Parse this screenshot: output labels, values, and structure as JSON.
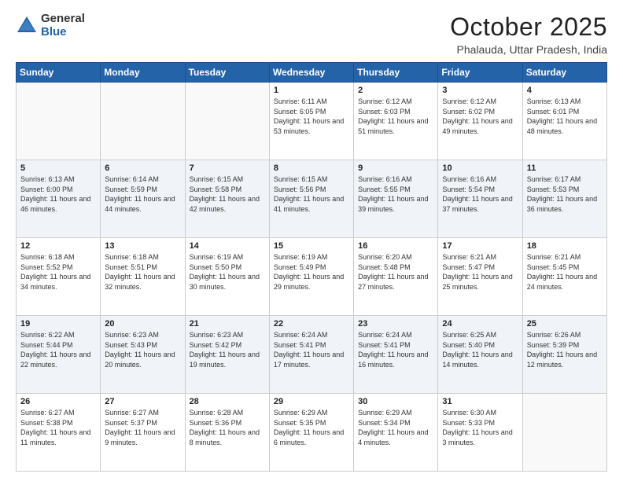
{
  "header": {
    "logo_general": "General",
    "logo_blue": "Blue",
    "title": "October 2025",
    "location": "Phalauda, Uttar Pradesh, India"
  },
  "days_of_week": [
    "Sunday",
    "Monday",
    "Tuesday",
    "Wednesday",
    "Thursday",
    "Friday",
    "Saturday"
  ],
  "weeks": [
    [
      {
        "day": "",
        "text": ""
      },
      {
        "day": "",
        "text": ""
      },
      {
        "day": "",
        "text": ""
      },
      {
        "day": "1",
        "text": "Sunrise: 6:11 AM\nSunset: 6:05 PM\nDaylight: 11 hours and 53 minutes."
      },
      {
        "day": "2",
        "text": "Sunrise: 6:12 AM\nSunset: 6:03 PM\nDaylight: 11 hours and 51 minutes."
      },
      {
        "day": "3",
        "text": "Sunrise: 6:12 AM\nSunset: 6:02 PM\nDaylight: 11 hours and 49 minutes."
      },
      {
        "day": "4",
        "text": "Sunrise: 6:13 AM\nSunset: 6:01 PM\nDaylight: 11 hours and 48 minutes."
      }
    ],
    [
      {
        "day": "5",
        "text": "Sunrise: 6:13 AM\nSunset: 6:00 PM\nDaylight: 11 hours and 46 minutes."
      },
      {
        "day": "6",
        "text": "Sunrise: 6:14 AM\nSunset: 5:59 PM\nDaylight: 11 hours and 44 minutes."
      },
      {
        "day": "7",
        "text": "Sunrise: 6:15 AM\nSunset: 5:58 PM\nDaylight: 11 hours and 42 minutes."
      },
      {
        "day": "8",
        "text": "Sunrise: 6:15 AM\nSunset: 5:56 PM\nDaylight: 11 hours and 41 minutes."
      },
      {
        "day": "9",
        "text": "Sunrise: 6:16 AM\nSunset: 5:55 PM\nDaylight: 11 hours and 39 minutes."
      },
      {
        "day": "10",
        "text": "Sunrise: 6:16 AM\nSunset: 5:54 PM\nDaylight: 11 hours and 37 minutes."
      },
      {
        "day": "11",
        "text": "Sunrise: 6:17 AM\nSunset: 5:53 PM\nDaylight: 11 hours and 36 minutes."
      }
    ],
    [
      {
        "day": "12",
        "text": "Sunrise: 6:18 AM\nSunset: 5:52 PM\nDaylight: 11 hours and 34 minutes."
      },
      {
        "day": "13",
        "text": "Sunrise: 6:18 AM\nSunset: 5:51 PM\nDaylight: 11 hours and 32 minutes."
      },
      {
        "day": "14",
        "text": "Sunrise: 6:19 AM\nSunset: 5:50 PM\nDaylight: 11 hours and 30 minutes."
      },
      {
        "day": "15",
        "text": "Sunrise: 6:19 AM\nSunset: 5:49 PM\nDaylight: 11 hours and 29 minutes."
      },
      {
        "day": "16",
        "text": "Sunrise: 6:20 AM\nSunset: 5:48 PM\nDaylight: 11 hours and 27 minutes."
      },
      {
        "day": "17",
        "text": "Sunrise: 6:21 AM\nSunset: 5:47 PM\nDaylight: 11 hours and 25 minutes."
      },
      {
        "day": "18",
        "text": "Sunrise: 6:21 AM\nSunset: 5:45 PM\nDaylight: 11 hours and 24 minutes."
      }
    ],
    [
      {
        "day": "19",
        "text": "Sunrise: 6:22 AM\nSunset: 5:44 PM\nDaylight: 11 hours and 22 minutes."
      },
      {
        "day": "20",
        "text": "Sunrise: 6:23 AM\nSunset: 5:43 PM\nDaylight: 11 hours and 20 minutes."
      },
      {
        "day": "21",
        "text": "Sunrise: 6:23 AM\nSunset: 5:42 PM\nDaylight: 11 hours and 19 minutes."
      },
      {
        "day": "22",
        "text": "Sunrise: 6:24 AM\nSunset: 5:41 PM\nDaylight: 11 hours and 17 minutes."
      },
      {
        "day": "23",
        "text": "Sunrise: 6:24 AM\nSunset: 5:41 PM\nDaylight: 11 hours and 16 minutes."
      },
      {
        "day": "24",
        "text": "Sunrise: 6:25 AM\nSunset: 5:40 PM\nDaylight: 11 hours and 14 minutes."
      },
      {
        "day": "25",
        "text": "Sunrise: 6:26 AM\nSunset: 5:39 PM\nDaylight: 11 hours and 12 minutes."
      }
    ],
    [
      {
        "day": "26",
        "text": "Sunrise: 6:27 AM\nSunset: 5:38 PM\nDaylight: 11 hours and 11 minutes."
      },
      {
        "day": "27",
        "text": "Sunrise: 6:27 AM\nSunset: 5:37 PM\nDaylight: 11 hours and 9 minutes."
      },
      {
        "day": "28",
        "text": "Sunrise: 6:28 AM\nSunset: 5:36 PM\nDaylight: 11 hours and 8 minutes."
      },
      {
        "day": "29",
        "text": "Sunrise: 6:29 AM\nSunset: 5:35 PM\nDaylight: 11 hours and 6 minutes."
      },
      {
        "day": "30",
        "text": "Sunrise: 6:29 AM\nSunset: 5:34 PM\nDaylight: 11 hours and 4 minutes."
      },
      {
        "day": "31",
        "text": "Sunrise: 6:30 AM\nSunset: 5:33 PM\nDaylight: 11 hours and 3 minutes."
      },
      {
        "day": "",
        "text": ""
      }
    ]
  ]
}
